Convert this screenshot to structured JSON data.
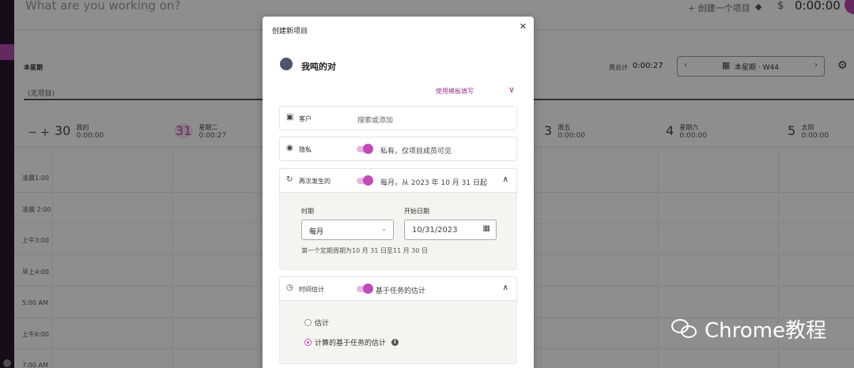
{
  "app": {
    "tracker_placeholder": "What are you working on?",
    "create_project": "+ 创建一个项目",
    "timer": "0:00:00",
    "week_label": "本星期",
    "total_label": "周总计",
    "total_value": "0:00:27",
    "week_picker_label": "本星期 · W44",
    "no_project": "(无项目)",
    "days": [
      {
        "num": "30",
        "name": "我的",
        "time": "0:00:00"
      },
      {
        "num": "31",
        "name": "星期二",
        "time": "0:00:27"
      },
      {
        "num": "3",
        "name": "周五",
        "time": "0:00:00"
      },
      {
        "num": "4",
        "name": "星期六",
        "time": "0:00:00"
      },
      {
        "num": "5",
        "name": "太阳",
        "time": "0:00:00"
      }
    ],
    "hours": [
      "凌晨1:00",
      "凌晨 2:00",
      "上午3:00",
      "早上4:00",
      "5:00 AM",
      "上午6:00",
      "7:00 AM"
    ]
  },
  "modal": {
    "title": "创建新项目",
    "project_name": "我吨的对",
    "project_color": "#4b5566",
    "template_link": "使用模板填写",
    "client": {
      "label": "客户",
      "placeholder": "搜索或添加"
    },
    "privacy": {
      "label": "隐私",
      "value": "私有，仅项目成员可见"
    },
    "recurring": {
      "label": "再次发生的",
      "value": "每月，从 2023 年 10 月 31 日起",
      "period_label": "时期",
      "period_value": "每月",
      "start_label": "开始日期",
      "start_value": "10/31/2023",
      "note": "第一个定期周期为10 月 31 日至11 月 30 日"
    },
    "estimate": {
      "label": "时间估计",
      "value": "基于任务的估计",
      "option1": "估计",
      "option2": "计算的基于任务的估计"
    }
  },
  "watermark": "Chrome教程",
  "colors": {
    "accent": "#c04bb7",
    "sidebar": "#2a1630"
  }
}
